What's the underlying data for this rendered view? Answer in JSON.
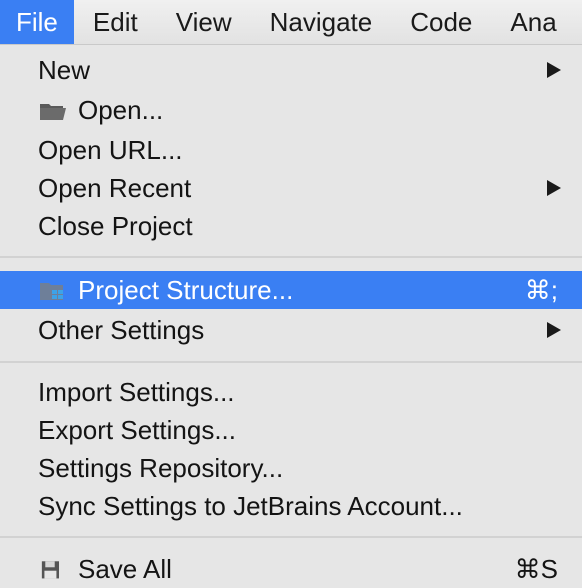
{
  "menubar": {
    "items": [
      {
        "label": "File"
      },
      {
        "label": "Edit"
      },
      {
        "label": "View"
      },
      {
        "label": "Navigate"
      },
      {
        "label": "Code"
      },
      {
        "label": "Ana"
      }
    ]
  },
  "file_menu": {
    "new": {
      "label": "New"
    },
    "open": {
      "label": "Open...",
      "icon": "folder-icon"
    },
    "open_url": {
      "label": "Open URL..."
    },
    "open_recent": {
      "label": "Open Recent"
    },
    "close_project": {
      "label": "Close Project"
    },
    "project_structure": {
      "label": "Project Structure...",
      "shortcut": "⌘;",
      "icon": "project-structure-icon"
    },
    "other_settings": {
      "label": "Other Settings"
    },
    "import_settings": {
      "label": "Import Settings..."
    },
    "export_settings": {
      "label": "Export Settings..."
    },
    "settings_repository": {
      "label": "Settings Repository..."
    },
    "sync_settings": {
      "label": "Sync Settings to JetBrains Account..."
    },
    "save_all": {
      "label": "Save All",
      "shortcut": "⌘S",
      "icon": "save-icon"
    }
  },
  "colors": {
    "highlight": "#3a7ff3",
    "menu_background": "#e6e6e6"
  }
}
